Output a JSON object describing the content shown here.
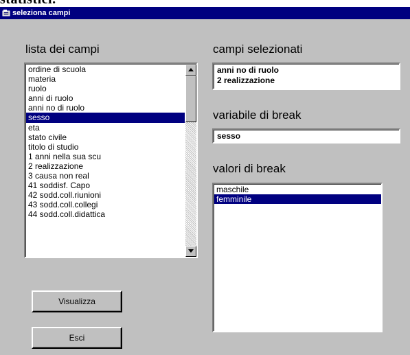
{
  "top_fragment": "statistici.",
  "window": {
    "title": "seleziona campi"
  },
  "fields_list": {
    "label": "lista dei campi",
    "items": [
      "ordine di scuola",
      "materia",
      "ruolo",
      "anni di ruolo",
      "anni no di ruolo",
      "sesso",
      "eta",
      "stato civile",
      "titolo di studio",
      "1 anni nella sua scu",
      "2 realizzazione",
      "3 causa non real",
      "41 soddisf. Capo",
      "42 sodd.coll.riunioni",
      "43 sodd.coll.collegi",
      "44 sodd.coll.didattica"
    ],
    "selected_index": 5,
    "scroll_position": 0
  },
  "selected_fields": {
    "label": "campi selezionati",
    "items": [
      "anni no di ruolo",
      "2 realizzazione"
    ]
  },
  "break_variable": {
    "label": "variabile di break",
    "value": "sesso"
  },
  "break_values": {
    "label": "valori di break",
    "items": [
      "maschile",
      "femminile"
    ],
    "selected_index": 1
  },
  "buttons": {
    "view_label": "Visualizza",
    "exit_label": "Esci"
  }
}
